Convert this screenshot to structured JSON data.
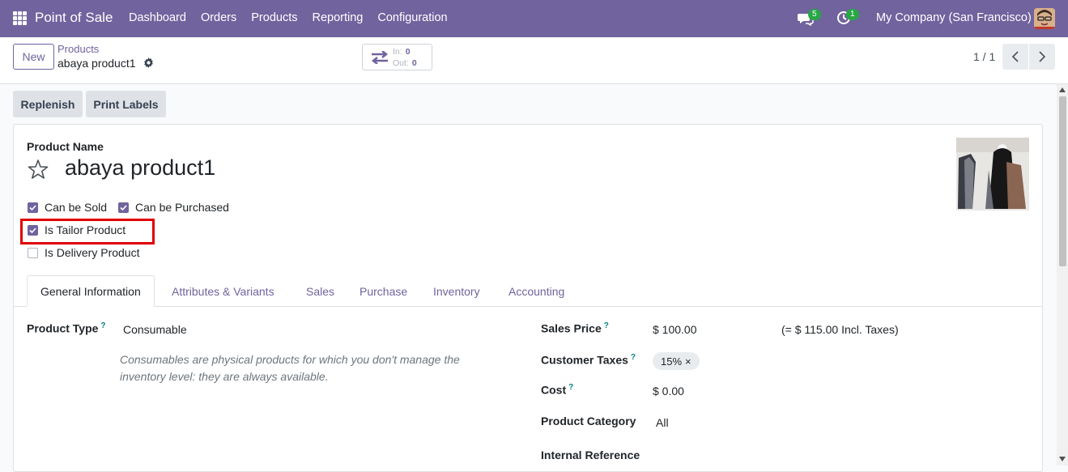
{
  "topbar": {
    "brand": "Point of Sale",
    "menu": [
      "Dashboard",
      "Orders",
      "Products",
      "Reporting",
      "Configuration"
    ],
    "chat_badge": "5",
    "activity_badge": "1",
    "company": "My Company (San Francisco)"
  },
  "control": {
    "new_label": "New",
    "breadcrumb_parent": "Products",
    "breadcrumb_current": "abaya product1",
    "in_label": "In:",
    "in_value": "0",
    "out_label": "Out:",
    "out_value": "0",
    "pager": "1 / 1"
  },
  "actions": {
    "replenish": "Replenish",
    "print_labels": "Print Labels"
  },
  "form": {
    "name_label": "Product Name",
    "name": "abaya product1",
    "checkboxes": [
      {
        "label": "Can be Sold",
        "checked": true
      },
      {
        "label": "Can be Purchased",
        "checked": true
      },
      {
        "label": "Is Tailor Product",
        "checked": true
      },
      {
        "label": "Is Delivery Product",
        "checked": false
      }
    ],
    "tabs": [
      "General Information",
      "Attributes & Variants",
      "Sales",
      "Purchase",
      "Inventory",
      "Accounting"
    ],
    "help_mark": "?",
    "product_type_label": "Product Type",
    "product_type": "Consumable",
    "product_type_note": "Consumables are physical products for which you don't manage the inventory level: they are always available.",
    "sales_price_label": "Sales Price",
    "sales_price": "$ 100.00",
    "sales_price_incl": "(= $ 115.00 Incl. Taxes)",
    "customer_taxes_label": "Customer Taxes",
    "customer_tax_tag": "15%",
    "tag_remove": "×",
    "cost_label": "Cost",
    "cost": "$ 0.00",
    "category_label": "Product Category",
    "category": "All",
    "internal_ref_label": "Internal Reference"
  },
  "colors": {
    "brand": "#71639e",
    "highlight": "#e00000",
    "badge": "#28a745"
  }
}
